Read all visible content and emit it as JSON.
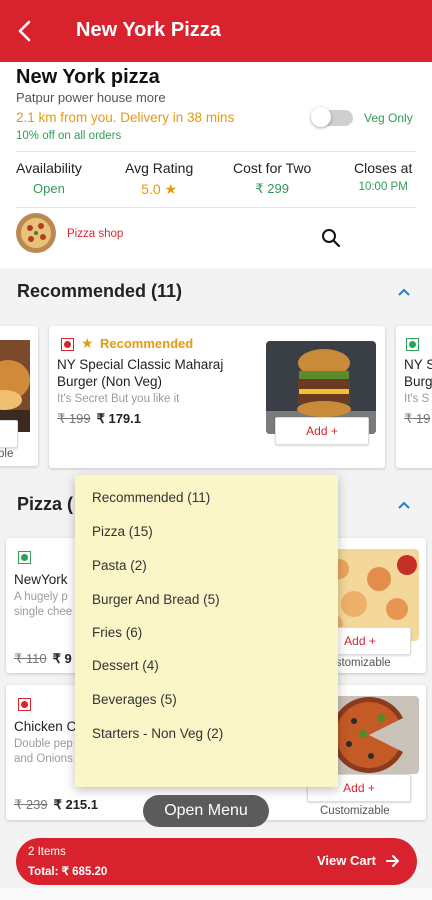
{
  "header": {
    "title": "New York Pizza"
  },
  "restaurant": {
    "name": "New York pizza",
    "address": "Patpur power house more",
    "distance": "2.1 km from you. Delivery in 38 mins",
    "offer": "10% off on all orders",
    "veg_only_label": "Veg Only"
  },
  "stats": {
    "availability_label": "Availability",
    "availability_value": "Open",
    "rating_label": "Avg Rating",
    "rating_value": "5.0",
    "cost_label": "Cost for Two",
    "cost_value": "₹ 299",
    "closes_label": "Closes at",
    "closes_value": "10:00 PM"
  },
  "shop": {
    "label": "Pizza shop"
  },
  "sections": {
    "recommended": "Recommended (11)",
    "pizza": "Pizza ("
  },
  "recommended_cards": {
    "left_partial": {
      "btn_tail": "ble"
    },
    "main": {
      "badge": "Recommended",
      "name_line1": "NY Special Classic Maharaj",
      "name_line2": "Burger (Non Veg)",
      "desc": "It's Secret But you like it",
      "old_price": "₹ 199",
      "new_price": "₹ 179.1",
      "add": "Add +"
    },
    "right_partial": {
      "name1": "NY S",
      "name2": "Burg",
      "desc": "It's S",
      "price": "₹ 19"
    }
  },
  "pizza_items": [
    {
      "name": "NewYork",
      "desc1": "A hugely p",
      "desc2": "single chee",
      "old_price": "₹ 110",
      "new_price": "₹ 9",
      "add": "Add +",
      "customizable": "Customizable"
    },
    {
      "name": "Chicken C",
      "desc1": "Double pep",
      "desc2": "and Onions",
      "old_price": "₹ 239",
      "new_price": "₹ 215.1",
      "add": "Add +",
      "customizable": "Customizable"
    }
  ],
  "menu_popup": {
    "items": [
      "Recommended (11)",
      "Pizza (15)",
      "Pasta (2)",
      "Burger And Bread (5)",
      "Fries (6)",
      "Dessert (4)",
      "Beverages (5)",
      "Starters - Non Veg (2)"
    ]
  },
  "open_menu_label": "Open Menu",
  "cart": {
    "items": "2 Items",
    "total": "Total: ₹ 685.20",
    "view_cart": "View Cart"
  },
  "colors": {
    "brand": "#d8232f",
    "veg": "#2ea05a",
    "accent": "#e69a10",
    "menu_bg": "#fbf6c7"
  }
}
